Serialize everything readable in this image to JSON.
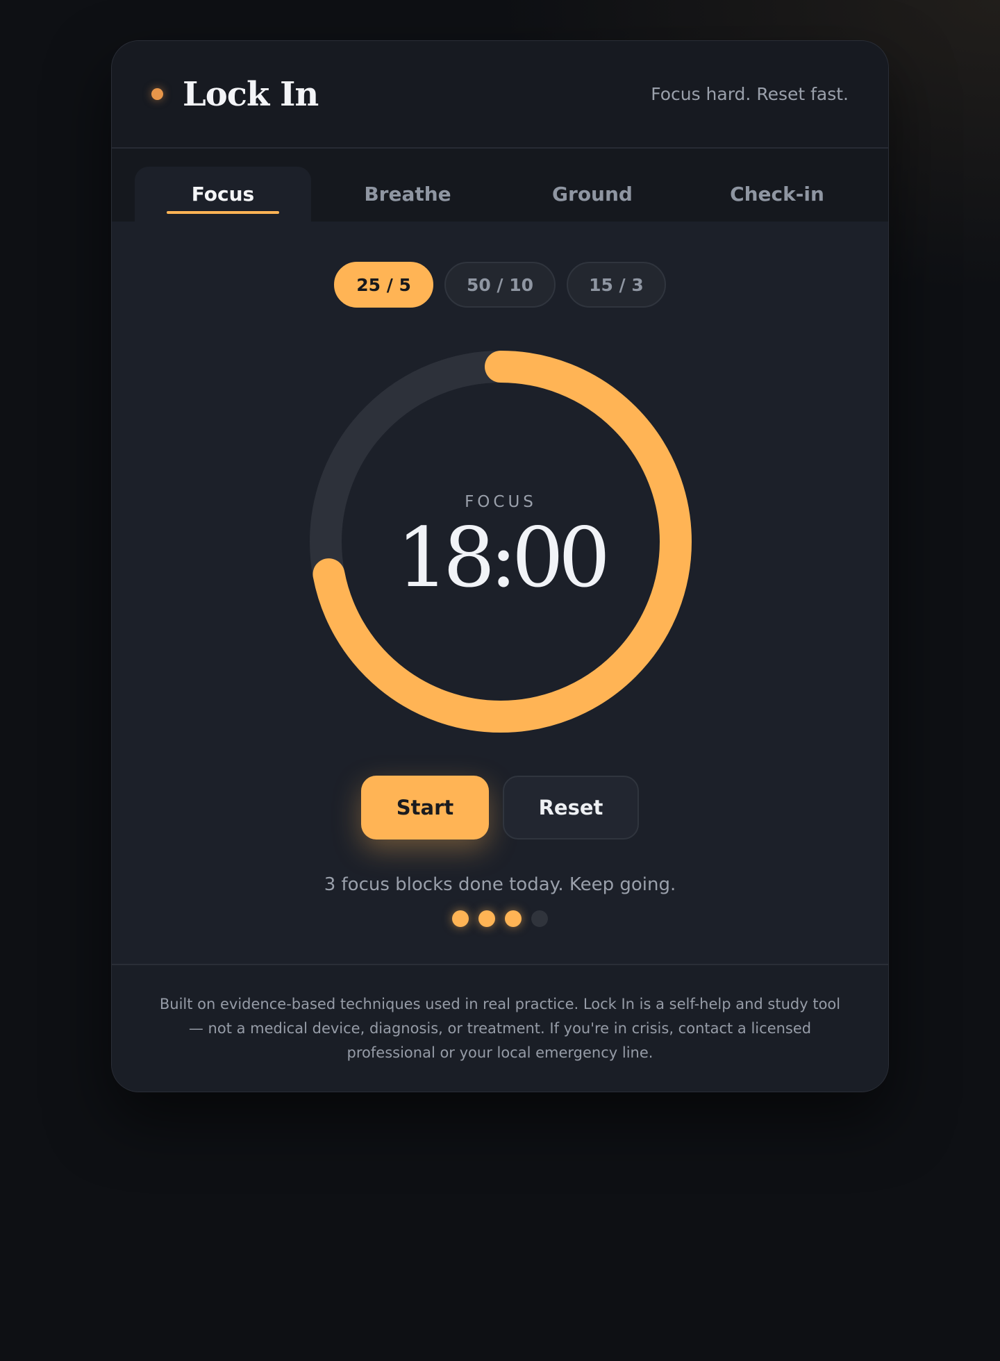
{
  "header": {
    "title": "Lock In",
    "tagline": "Focus hard. Reset fast."
  },
  "tabs": [
    {
      "label": "Focus",
      "active": true
    },
    {
      "label": "Breathe",
      "active": false
    },
    {
      "label": "Ground",
      "active": false
    },
    {
      "label": "Check-in",
      "active": false
    }
  ],
  "presets": [
    {
      "label": "25 / 5",
      "selected": true
    },
    {
      "label": "50 / 10",
      "selected": false
    },
    {
      "label": "15 / 3",
      "selected": false
    }
  ],
  "timer": {
    "mode": "FOCUS",
    "time": "18:00",
    "remaining_fraction": 0.72
  },
  "buttons": {
    "start_label": "Start",
    "reset_label": "Reset"
  },
  "status": {
    "message": "3 focus blocks done today. Keep going.",
    "blocks_done": 3,
    "blocks_total": 4
  },
  "footer": {
    "disclaimer": "Built on evidence-based techniques used in real practice. Lock In is a self-help and study tool — not a medical device, diagnosis, or treatment. If you're in crisis, contact a licensed professional or your local emergency line."
  },
  "colors": {
    "accent": "#ffb455",
    "brand_dot": "#e8964a",
    "card_bg": "#1c2029",
    "track": "#2d313a"
  }
}
